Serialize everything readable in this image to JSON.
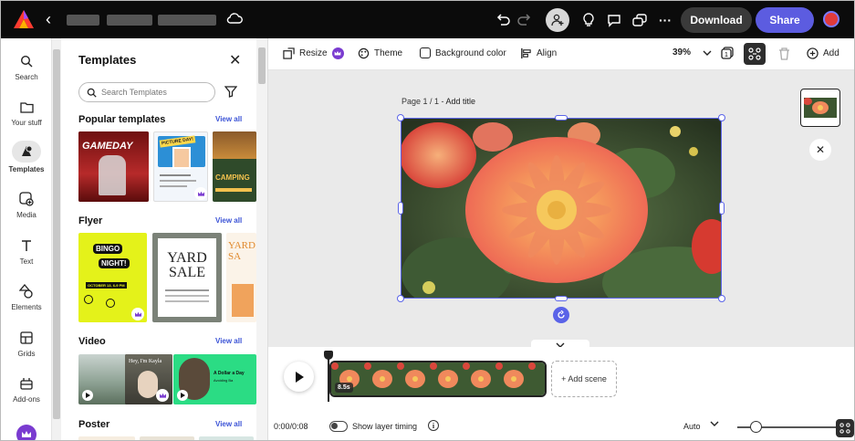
{
  "topbar": {
    "download_label": "Download",
    "share_label": "Share",
    "icons": [
      "adobe-express-logo",
      "back-arrow",
      "cloud-icon",
      "undo-icon",
      "redo-icon",
      "invite-icon",
      "lightbulb-icon",
      "comment-icon",
      "duplicate-icon",
      "more-icon",
      "avatar"
    ]
  },
  "rail": {
    "items": [
      {
        "label": "Search",
        "icon": "search-icon"
      },
      {
        "label": "Your stuff",
        "icon": "folder-icon"
      },
      {
        "label": "Templates",
        "icon": "templates-icon",
        "active": true
      },
      {
        "label": "Media",
        "icon": "media-icon"
      },
      {
        "label": "Text",
        "icon": "text-icon"
      },
      {
        "label": "Elements",
        "icon": "elements-icon"
      },
      {
        "label": "Grids",
        "icon": "grid-icon"
      },
      {
        "label": "Add-ons",
        "icon": "addons-icon"
      }
    ]
  },
  "panel": {
    "title": "Templates",
    "search_placeholder": "Search Templates",
    "sections": [
      {
        "title": "Popular templates",
        "view_all": "View all"
      },
      {
        "title": "Flyer",
        "view_all": "View all"
      },
      {
        "title": "Video",
        "view_all": "View all"
      },
      {
        "title": "Poster",
        "view_all": "View all"
      }
    ],
    "thumb_text": {
      "gameday": "GAMEDAY",
      "picture_day": "PICTURE DAY!",
      "camping": "CAMPING",
      "bingo": "BINGO",
      "night": "NIGHT!",
      "bingo_date": "OCTOBER 13, 6-9 PM",
      "yard": "YARD",
      "sale": "SALE",
      "yard_sale_side": "YARD SA",
      "video_hey": "Hey, I'm Kayla",
      "video_dollar": "A Dollar a Day",
      "video_dollar_sub": "Avoiding Ba"
    }
  },
  "toolbar": {
    "resize": "Resize",
    "theme": "Theme",
    "background_color": "Background color",
    "align": "Align",
    "zoom": "39%",
    "add": "Add"
  },
  "canvas": {
    "page_label": "Page 1 / 1 - ",
    "add_title": "Add title"
  },
  "timeline": {
    "clip_duration": "8.5s",
    "add_scene": "+ Add scene",
    "time": "0:00/0:08",
    "show_layer_timing": "Show layer timing",
    "auto": "Auto"
  },
  "colors": {
    "accent": "#5a63e8",
    "share": "#5c5ce0",
    "link": "#3b53d6"
  }
}
